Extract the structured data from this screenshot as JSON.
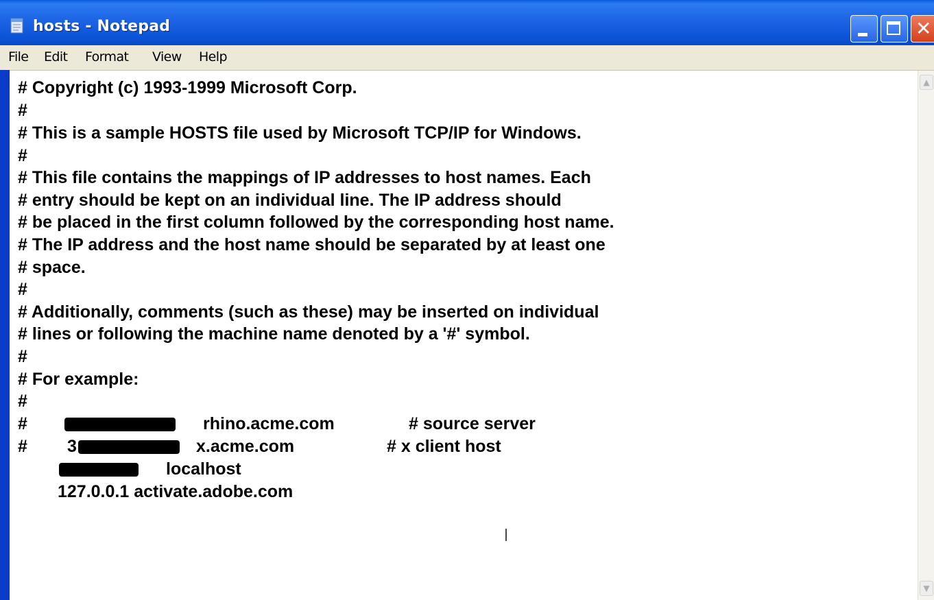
{
  "window": {
    "title": "hosts - Notepad",
    "icon": "notepad-icon",
    "controls": {
      "minimize": "minimize-icon",
      "maximize": "maximize-icon",
      "close": "close-icon"
    }
  },
  "menu": {
    "file": "File",
    "edit": "Edit",
    "format": "Format",
    "view": "View",
    "help": "Help"
  },
  "editor": {
    "lines": [
      "# Copyright (c) 1993-1999 Microsoft Corp.",
      "#",
      "# This is a sample HOSTS file used by Microsoft TCP/IP for Windows.",
      "#",
      "# This file contains the mappings of IP addresses to host names. Each",
      "# entry should be kept on an individual line. The IP address should",
      "# be placed in the first column followed by the corresponding host name.",
      "# The IP address and the host name should be separated by at least one",
      "# space.",
      "#",
      "# Additionally, comments (such as these) may be inserted on individual",
      "# lines or following the machine name denoted by a '#' symbol.",
      "#",
      "# For example:",
      "#"
    ],
    "example1": {
      "hash": "#",
      "host": "rhino.acme.com",
      "comment": "# source server"
    },
    "example2": {
      "hash": "#",
      "ip_visible": "3",
      "host": "x.acme.com",
      "comment": "# x client host"
    },
    "localhost_entry": "localhost",
    "adobe_entry": "127.0.0.1 activate.adobe.com"
  },
  "scrollbar": {
    "up": "scroll-up-icon",
    "down": "scroll-down-icon"
  },
  "colors": {
    "titlebar": "#0a5ae0",
    "menubar": "#ece9d8",
    "close": "#d4401c"
  }
}
